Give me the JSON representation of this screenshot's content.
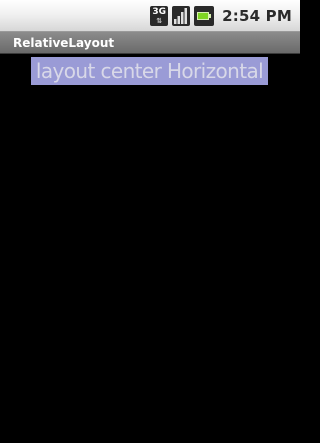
{
  "status_bar": {
    "network_type": "3G",
    "time": "2:54 PM",
    "icons": [
      "network-3g-icon",
      "signal-strength-icon",
      "battery-charging-icon"
    ],
    "colors": {
      "battery_fill": "#7ed321"
    }
  },
  "app": {
    "title": "RelativeLayout"
  },
  "content": {
    "centered_text": "layout center Horizontal",
    "colors": {
      "highlight_background": "#9a9bd6",
      "text": "#d8d8e8",
      "screen_background": "#000000"
    }
  }
}
